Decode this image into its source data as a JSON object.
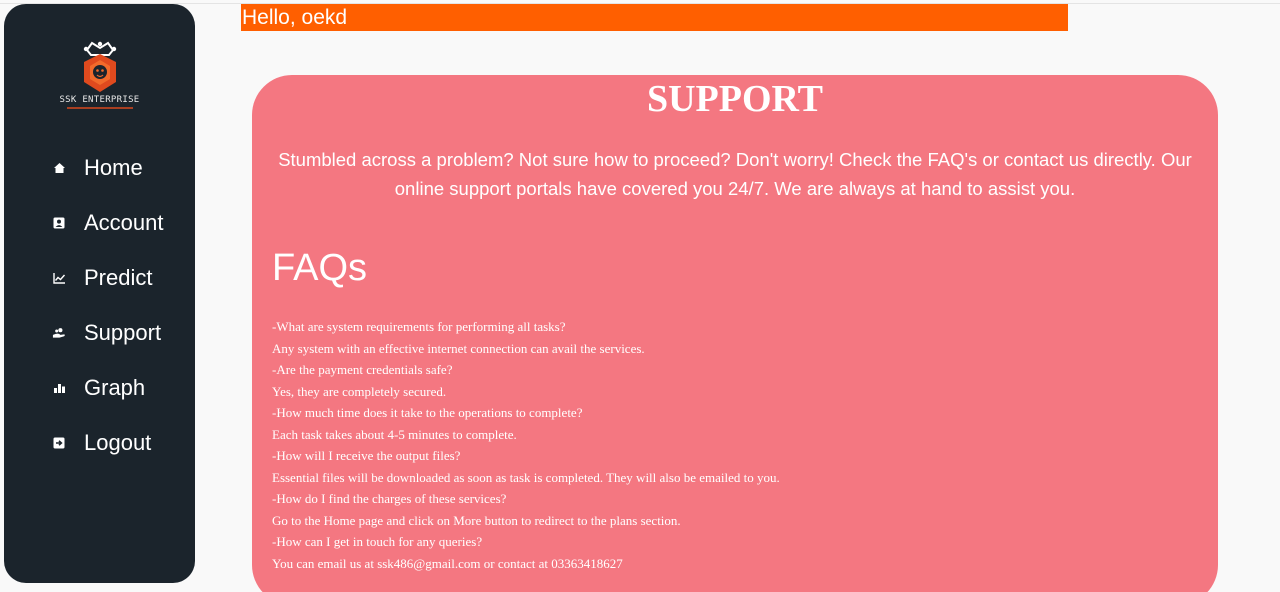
{
  "sidebar": {
    "brand": "SSK ENTERPRISE",
    "items": [
      {
        "label": "Home",
        "icon": "home-icon"
      },
      {
        "label": "Account",
        "icon": "account-icon"
      },
      {
        "label": "Predict",
        "icon": "chart-line-icon"
      },
      {
        "label": "Support",
        "icon": "support-icon"
      },
      {
        "label": "Graph",
        "icon": "bar-chart-icon"
      },
      {
        "label": "Logout",
        "icon": "logout-icon"
      }
    ]
  },
  "header": {
    "greeting": "Hello, oekd"
  },
  "support": {
    "title": "SUPPORT",
    "intro": "Stumbled across a problem? Not sure how to proceed? Don't worry! Check the FAQ's or contact us directly. Our online support portals have covered you 24/7. We are always at hand to assist you.",
    "faq_title": "FAQs",
    "faq_lines": [
      "-What are system requirements for performing all tasks?",
      "Any system with an effective internet connection can avail the services.",
      "-Are the payment credentials safe?",
      "Yes, they are completely secured.",
      "-How much time does it take to the operations to complete?",
      "Each task takes about 4-5 minutes to complete.",
      "-How will I receive the output files?",
      "Essential files will be downloaded as soon as task is completed. They will also be emailed to you.",
      "-How do I find the charges of these services?",
      "Go to the Home page and click on More button to redirect to the plans section.",
      "-How can I get in touch for any queries?",
      "You can email us at ssk486@gmail.com or contact at 03363418627"
    ]
  },
  "colors": {
    "sidebar_bg": "#1b242c",
    "greeting_bg": "#ff5f00",
    "card_bg": "#f47781",
    "page_bg": "#f9f9f9"
  }
}
